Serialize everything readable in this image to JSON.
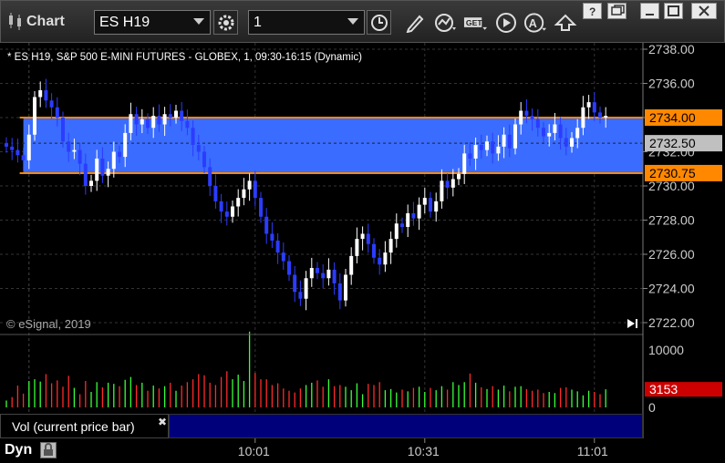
{
  "window": {
    "title": "Chart",
    "symbol": "ES H19",
    "interval": "1",
    "controls": [
      "question-icon",
      "restore-icon",
      "minimize-icon",
      "maximize-icon",
      "close-icon"
    ],
    "tools": [
      "clock-icon",
      "pencil-icon",
      "study-icon",
      "get-icon",
      "play-icon",
      "alert-icon",
      "arrow-icon"
    ]
  },
  "legend": "* ES H19, S&P 500 E-MINI FUTURES - GLOBEX, 1, 09:30-16:15 (Dynamic)",
  "watermark": "© eSignal, 2019",
  "volume_label": "Vol (current price bar)",
  "dyn_label": "Dyn",
  "colors": {
    "up_candle": "#ffffff",
    "down_candle": "#2b3cff",
    "zone": "#3a6cff",
    "level_line": "#ff8800",
    "vol_up": "#3aff3a",
    "vol_down": "#ff2a2a",
    "last_price": "#c0c0c0",
    "vol_marker": "#cc0000"
  },
  "chart_data": [
    {
      "type": "candlestick",
      "y_ticks": [
        "2738.00",
        "2736.00",
        "2734.00",
        "2732.00",
        "2730.00",
        "2728.00",
        "2726.00",
        "2724.00",
        "2722.00"
      ],
      "ylim": [
        2721.2,
        2738.8
      ],
      "x_ticks": [
        {
          "label": "10:01",
          "bar": 44
        },
        {
          "label": "10:31",
          "bar": 74
        },
        {
          "label": "11:01",
          "bar": 104
        }
      ],
      "zone": {
        "upper": 2734.0,
        "lower": 2730.75,
        "upper_label": "2734.00",
        "lower_label": "2730.75"
      },
      "last_price": {
        "value": 2732.5,
        "label": "2732.50"
      },
      "closes": [
        2732.3,
        2732.1,
        2731.8,
        2731.5,
        2733.0,
        2735.2,
        2735.6,
        2735.0,
        2734.6,
        2734.0,
        2732.6,
        2732.0,
        2732.1,
        2731.3,
        2730.0,
        2730.3,
        2731.6,
        2730.6,
        2731.0,
        2732.0,
        2731.7,
        2733.1,
        2734.2,
        2733.6,
        2733.9,
        2733.4,
        2734.1,
        2733.6,
        2734.2,
        2734.0,
        2734.4,
        2733.8,
        2733.4,
        2732.4,
        2732.0,
        2731.1,
        2730.0,
        2729.1,
        2728.5,
        2728.2,
        2728.8,
        2729.3,
        2729.8,
        2730.3,
        2729.3,
        2728.2,
        2727.2,
        2726.8,
        2726.1,
        2725.6,
        2724.8,
        2723.8,
        2723.4,
        2724.6,
        2725.2,
        2724.9,
        2724.6,
        2725.1,
        2724.3,
        2723.3,
        2724.8,
        2725.9,
        2726.9,
        2727.2,
        2726.6,
        2725.8,
        2725.4,
        2726.1,
        2726.9,
        2727.8,
        2727.6,
        2728.4,
        2728.1,
        2728.9,
        2729.3,
        2728.5,
        2729.1,
        2730.3,
        2729.9,
        2730.4,
        2730.7,
        2731.9,
        2731.6,
        2732.4,
        2732.1,
        2732.6,
        2731.9,
        2732.3,
        2733.0,
        2732.2,
        2733.6,
        2734.4,
        2734.1,
        2733.9,
        2733.4,
        2732.9,
        2733.1,
        2733.6,
        2732.8,
        2732.3,
        2732.8,
        2733.4,
        2734.6,
        2734.9,
        2734.3,
        2734.0,
        2734.1
      ]
    },
    {
      "type": "bar",
      "name": "Vol (current price bar)",
      "y_ticks": [
        "10000",
        "0"
      ],
      "ylim": [
        0,
        13000
      ],
      "current_value": 3153,
      "current_label": "3153",
      "values": [
        1200,
        1800,
        3800,
        2400,
        4600,
        4900,
        4500,
        5800,
        4200,
        4700,
        3600,
        5500,
        3400,
        2300,
        4600,
        2700,
        4400,
        3500,
        4300,
        4100,
        3700,
        4800,
        5300,
        3900,
        4300,
        2900,
        3800,
        3300,
        3700,
        4300,
        2900,
        3800,
        4400,
        4900,
        5800,
        5600,
        4300,
        3900,
        5300,
        6300,
        4900,
        5700,
        4600,
        13200,
        6000,
        4900,
        4900,
        3900,
        4200,
        3300,
        2900,
        2600,
        3300,
        3900,
        4300,
        4700,
        3600,
        4900,
        3700,
        3900,
        3600,
        3000,
        4200,
        2300,
        4100,
        3900,
        4400,
        3000,
        3200,
        2600,
        3100,
        2800,
        3400,
        3600,
        2700,
        3400,
        3000,
        3700,
        3100,
        4400,
        3900,
        4400,
        5900,
        4300,
        3500,
        3200,
        3700,
        3100,
        3800,
        2800,
        3600,
        3700,
        3200,
        2900,
        3100,
        2500,
        2700,
        2500,
        3400,
        3500,
        3100,
        2800,
        2100,
        2900,
        2700,
        2300,
        3153
      ]
    }
  ]
}
